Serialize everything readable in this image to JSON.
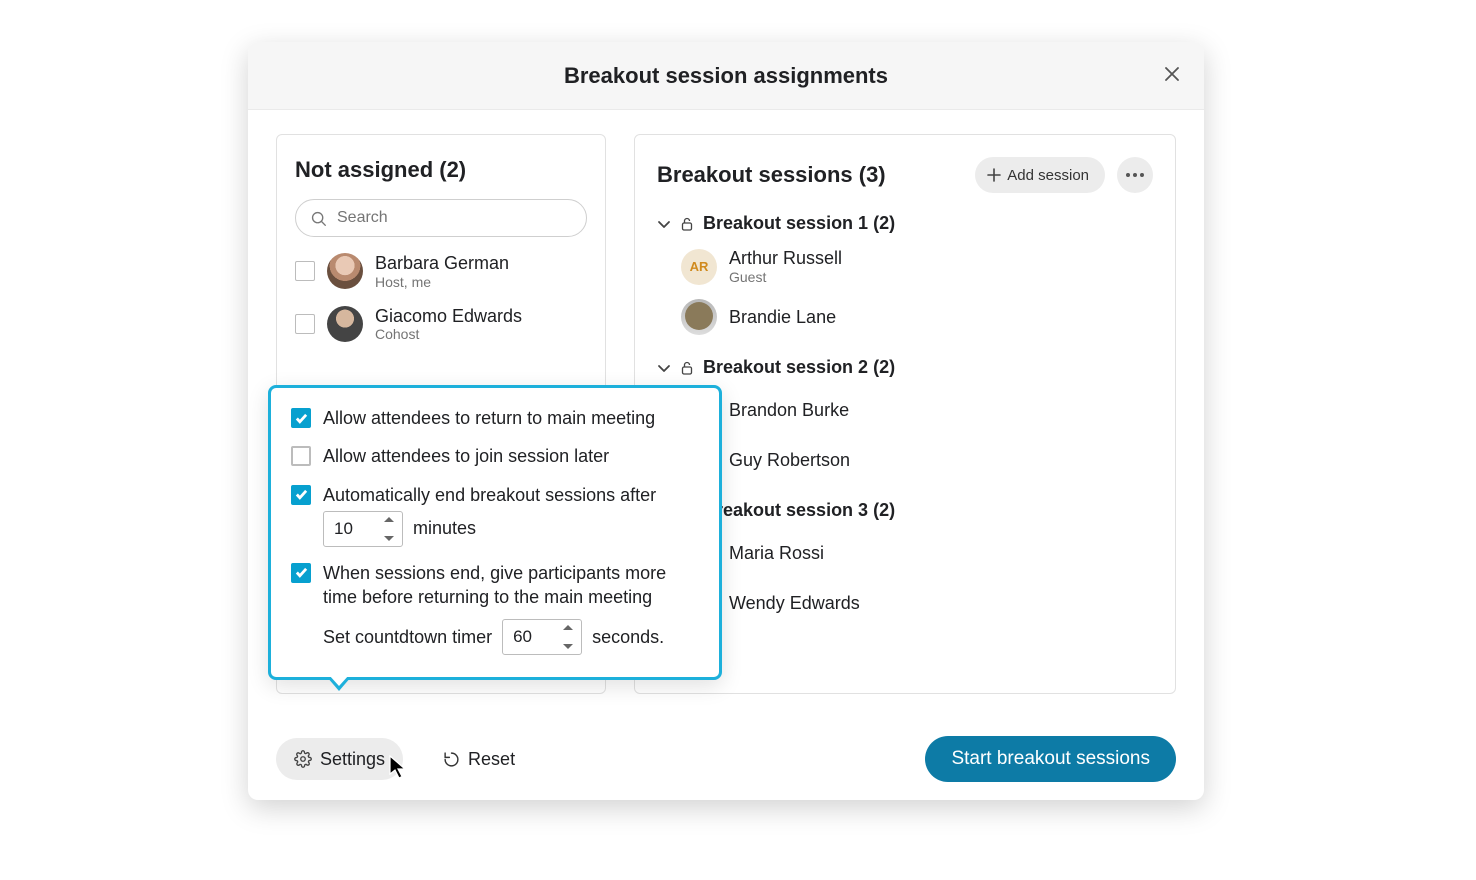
{
  "dialog": {
    "title": "Breakout session assignments"
  },
  "left": {
    "title": "Not assigned (2)",
    "search_placeholder": "Search",
    "users": [
      {
        "name": "Barbara German",
        "role": "Host, me"
      },
      {
        "name": "Giacomo Edwards",
        "role": "Cohost"
      }
    ]
  },
  "right": {
    "title": "Breakout sessions (3)",
    "add_label": "Add session",
    "sessions": [
      {
        "title": "Breakout session 1 (2)",
        "members": [
          {
            "name": "Arthur Russell",
            "role": "Guest",
            "initials": "AR"
          },
          {
            "name": "Brandie Lane",
            "role": ""
          }
        ]
      },
      {
        "title": "Breakout session 2 (2)",
        "members": [
          {
            "name": "Brandon Burke",
            "role": ""
          },
          {
            "name": "Guy Robertson",
            "role": ""
          }
        ]
      },
      {
        "title": "Breakout session 3 (2)",
        "members": [
          {
            "name": "Maria Rossi",
            "role": ""
          },
          {
            "name": "Wendy Edwards",
            "role": ""
          }
        ]
      }
    ]
  },
  "settings_popover": {
    "opt1": "Allow attendees to return to main meeting",
    "opt2": "Allow attendees to join session later",
    "opt3": "Automatically end breakout sessions after",
    "minutes_value": "10",
    "minutes_label": "minutes",
    "opt4": "When sessions end, give participants more time before returning to the main meeting",
    "countdown_prefix": "Set countdtown timer",
    "seconds_value": "60",
    "seconds_label": "seconds."
  },
  "footer": {
    "settings_label": "Settings",
    "reset_label": "Reset",
    "start_label": "Start breakout sessions"
  }
}
